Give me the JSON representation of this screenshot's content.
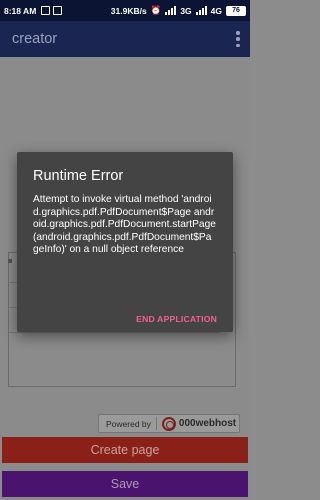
{
  "status_bar": {
    "time": "8:18 AM",
    "speed": "31.9KB/s",
    "network": "3G",
    "network2": "4G",
    "battery": "76"
  },
  "app_bar": {
    "title": "creator"
  },
  "footer": {
    "powered_by_label": "Powered by",
    "host_name": "000webhost"
  },
  "buttons": {
    "create_page": "Create page",
    "save": "Save"
  },
  "dialog": {
    "title": "Runtime Error",
    "message": "Attempt to invoke virtual method 'android.graphics.pdf.PdfDocument$Page android.graphics.pdf.PdfDocument.startPage(android.graphics.pdf.PdfDocument$PageInfo)' on a null object reference",
    "action": "END APPLICATION"
  },
  "colors": {
    "status_bar": "#0b1433",
    "app_bar": "#1b2551",
    "create_button": "#8a2017",
    "save_button": "#4a136e",
    "dialog_bg": "#444444",
    "dialog_action": "#f0618e"
  }
}
